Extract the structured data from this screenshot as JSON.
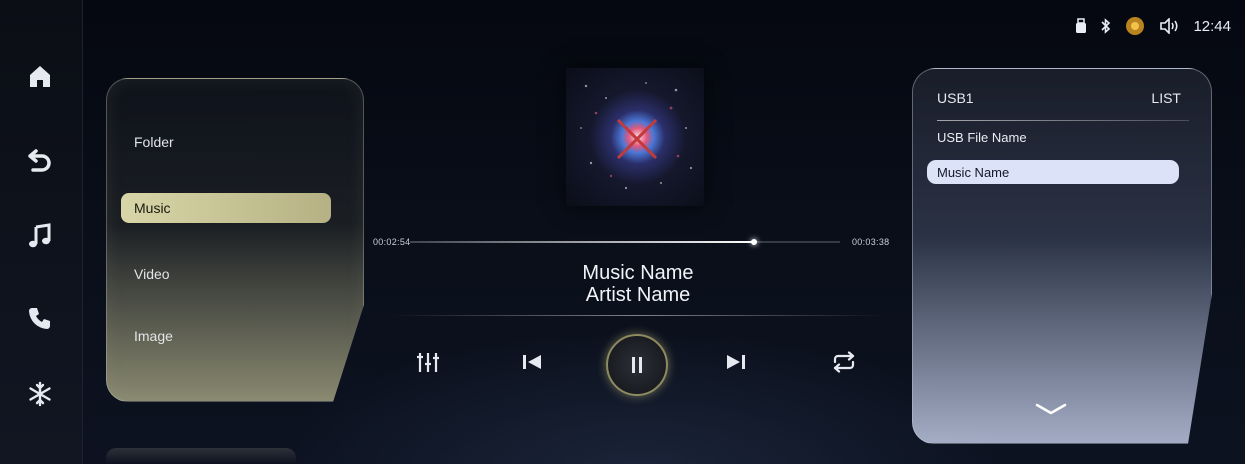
{
  "status_bar": {
    "time": "12:44",
    "icons": [
      "usb-icon",
      "bluetooth-icon",
      "sun-icon",
      "volume-icon"
    ]
  },
  "nav_rail": {
    "items": [
      "home-icon",
      "back-icon",
      "music-note-icon",
      "phone-icon",
      "snowflake-icon"
    ]
  },
  "source_menu": {
    "items": [
      {
        "label": "Folder",
        "active": false
      },
      {
        "label": "Music",
        "active": true
      },
      {
        "label": "Video",
        "active": false
      },
      {
        "label": "Image",
        "active": false
      }
    ]
  },
  "player": {
    "elapsed": "00:02:54",
    "total": "00:03:38",
    "progress": 0.8,
    "title": "Music Name",
    "artist": "Artist Name",
    "controls": [
      "equalizer-icon",
      "previous-icon",
      "pause-icon",
      "next-icon",
      "repeat-icon"
    ]
  },
  "file_list": {
    "source": "USB1",
    "mode": "LIST",
    "file_name": "USB File Name",
    "selected": "Music Name"
  },
  "colors": {
    "accent_menu": "#d8d6a8",
    "accent_list": "#dce2f8",
    "background": "#070a12"
  }
}
